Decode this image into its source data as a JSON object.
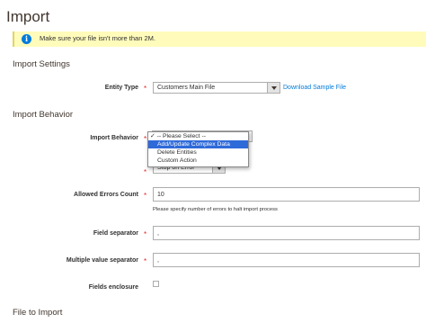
{
  "page": {
    "title": "Import"
  },
  "notice": {
    "text": "Make sure your file isn't more than 2M."
  },
  "import_settings": {
    "title": "Import Settings",
    "entity_type": {
      "label": "Entity Type",
      "value": "Customers Main File",
      "link": "Download Sample File"
    }
  },
  "import_behavior": {
    "title": "Import Behavior",
    "behavior": {
      "label": "Import Behavior",
      "options": [
        "-- Please Select --",
        "Add/Update Complex Data",
        "Delete Entities",
        "Custom Action"
      ],
      "checked": "-- Please Select --",
      "highlighted": "Add/Update Complex Data"
    },
    "validation_strategy": {
      "value": "Stop on Error"
    },
    "allowed_errors": {
      "label": "Allowed Errors Count",
      "value": "10",
      "note": "Please specify number of errors to halt import process"
    },
    "field_separator": {
      "label": "Field separator",
      "value": ","
    },
    "multiple_value_separator": {
      "label": "Multiple value separator",
      "value": ","
    },
    "fields_enclosure": {
      "label": "Fields enclosure",
      "checked": false
    }
  },
  "file_to_import": {
    "title": "File to Import"
  },
  "colors": {
    "required": "#e22626",
    "link": "#007bdb",
    "notice_bg": "#fffbbb",
    "highlight": "#2f6ad9"
  },
  "icons": {
    "notice": "info-icon",
    "dropdown": "chevron-down-icon",
    "checkmark": "checkmark-icon"
  }
}
